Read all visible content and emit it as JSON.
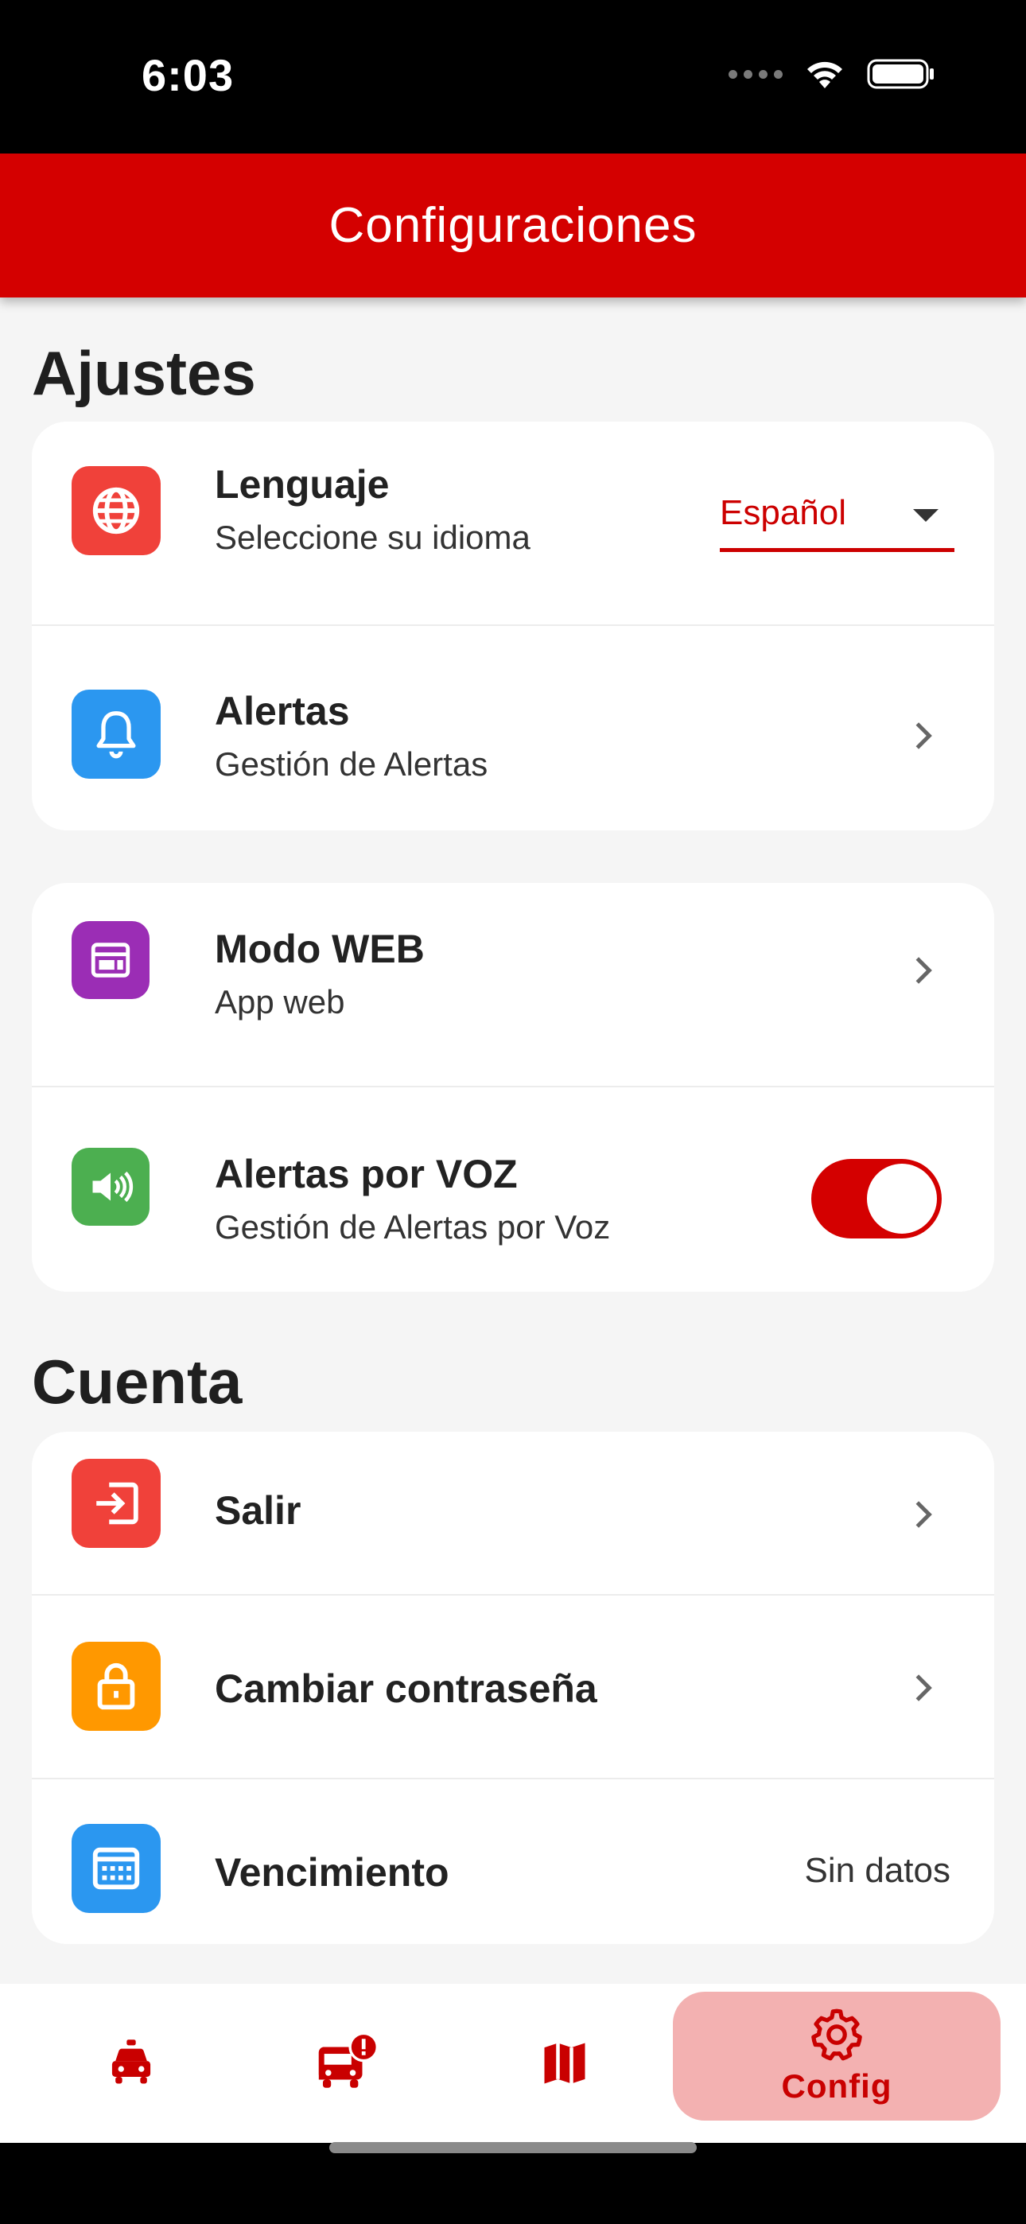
{
  "status_bar": {
    "time": "6:03"
  },
  "app_bar": {
    "title": "Configuraciones"
  },
  "sections": {
    "settings_title": "Ajustes",
    "account_title": "Cuenta"
  },
  "settings": {
    "language": {
      "title": "Lenguaje",
      "subtitle": "Seleccione su idioma",
      "selected": "Español"
    },
    "alerts": {
      "title": "Alertas",
      "subtitle": "Gestión de Alertas"
    },
    "web_mode": {
      "title": "Modo WEB",
      "subtitle": "App web"
    },
    "voice_alerts": {
      "title": "Alertas por VOZ",
      "subtitle": "Gestión de Alertas por Voz",
      "enabled": true
    }
  },
  "account": {
    "logout": {
      "title": "Salir"
    },
    "change_password": {
      "title": "Cambiar contraseña"
    },
    "expiration": {
      "title": "Vencimiento",
      "value": "Sin datos"
    }
  },
  "bottom_nav": {
    "items": [
      "car-icon",
      "bus-alert-icon",
      "map-icon",
      "gear-icon"
    ],
    "active_label": "Config"
  },
  "colors": {
    "primary": "#d40000",
    "icon_red": "#f0413a",
    "icon_blue": "#2b97f0",
    "icon_purple": "#9b2db5",
    "icon_green": "#4caf50",
    "icon_orange": "#ff9800",
    "active_nav_bg": "#f3b1b1"
  }
}
